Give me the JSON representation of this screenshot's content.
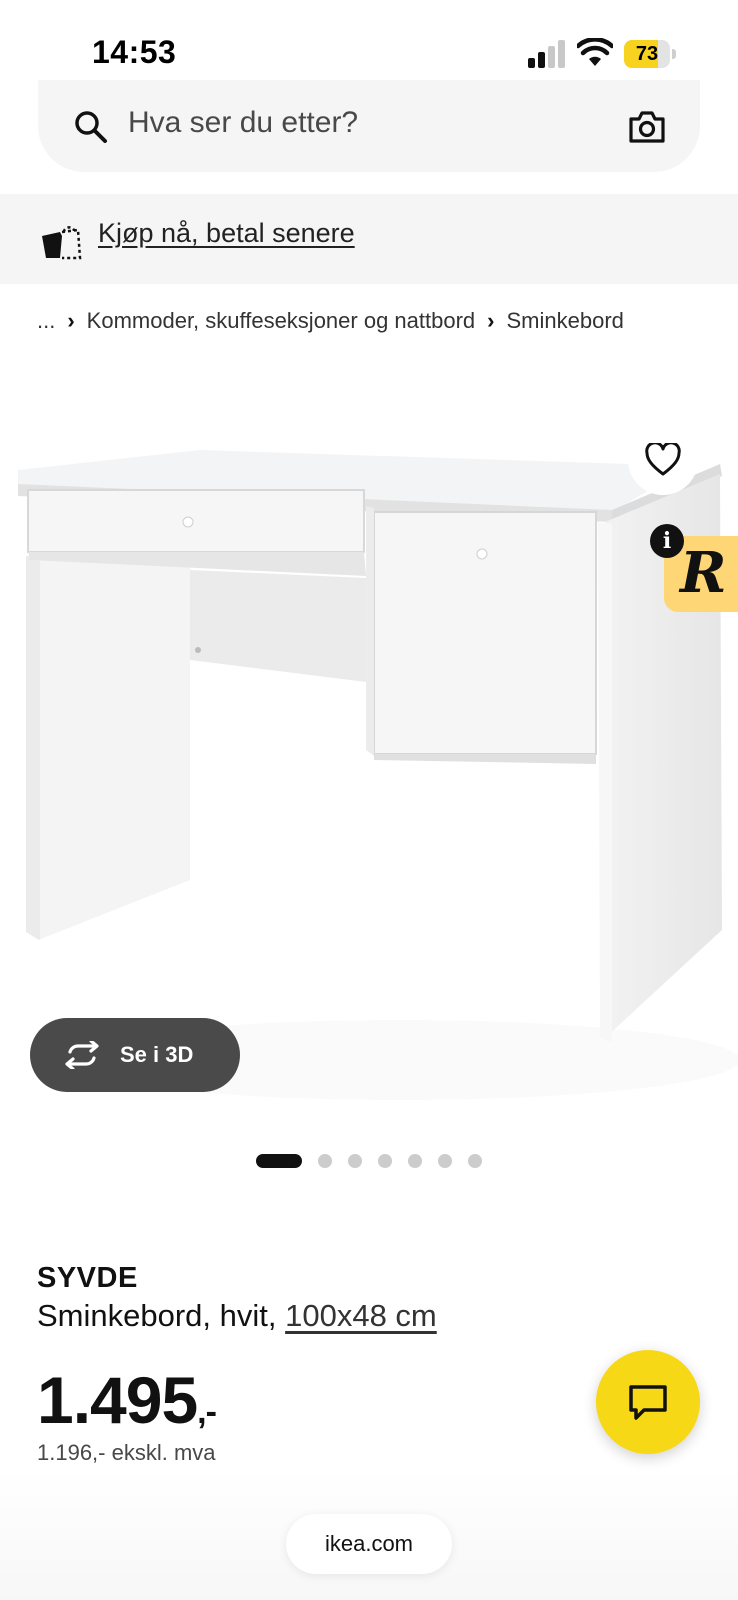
{
  "status_bar": {
    "time": "14:53",
    "battery": "73",
    "battery_level": 0.73
  },
  "search": {
    "placeholder": "Hva ser du etter?"
  },
  "promo": {
    "link_text": "Kjøp nå, betal senere"
  },
  "breadcrumb": {
    "items": [
      "...",
      "Kommoder, skuffeseksjoner og nattbord",
      "Sminkebord"
    ]
  },
  "gallery": {
    "view_3d_label": "Se i 3D",
    "image_count": 7,
    "active_index": 0
  },
  "badge": {
    "letter": "R",
    "info": "i"
  },
  "product": {
    "name": "SYVDE",
    "description": "Sminkebord, hvit, ",
    "size": "100x48 cm",
    "price": "1.495",
    "price_suffix": ",-",
    "price_ex_vat": "1.196,- ekskl. mva"
  },
  "browser": {
    "url": "ikea.com"
  },
  "colors": {
    "accent_yellow": "#f7d817",
    "dark_button": "#4a4a4a",
    "surface": "#f5f5f5"
  },
  "icons": [
    "signal-icon",
    "wifi-icon",
    "battery-icon",
    "search-icon",
    "camera-icon",
    "bnpl-icon",
    "heart-icon",
    "info-icon",
    "rotate-3d-icon",
    "chat-icon"
  ]
}
